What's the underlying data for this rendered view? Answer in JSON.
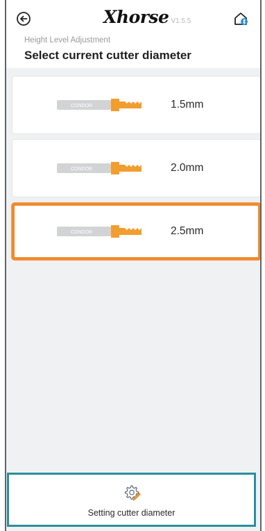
{
  "header": {
    "logo_text": "Xhorse",
    "version": "V1.5.5",
    "subtitle": "Height Level Adjustment",
    "title": "Select current cutter diameter"
  },
  "icons": {
    "back": "back-arrow-icon",
    "home": "home-bluetooth-icon",
    "setting": "gear-pencil-icon"
  },
  "cutters": [
    {
      "brand": "CONDOR",
      "diameter": "1.5mm",
      "selected": false
    },
    {
      "brand": "CONDOR",
      "diameter": "2.0mm",
      "selected": false
    },
    {
      "brand": "CONDOR",
      "diameter": "2.5mm",
      "selected": true
    }
  ],
  "footer": {
    "setting_label": "Setting cutter diameter"
  },
  "colors": {
    "accent_orange": "#f08a2c",
    "accent_teal": "#2a8f9a",
    "background": "#f0f1f3"
  }
}
